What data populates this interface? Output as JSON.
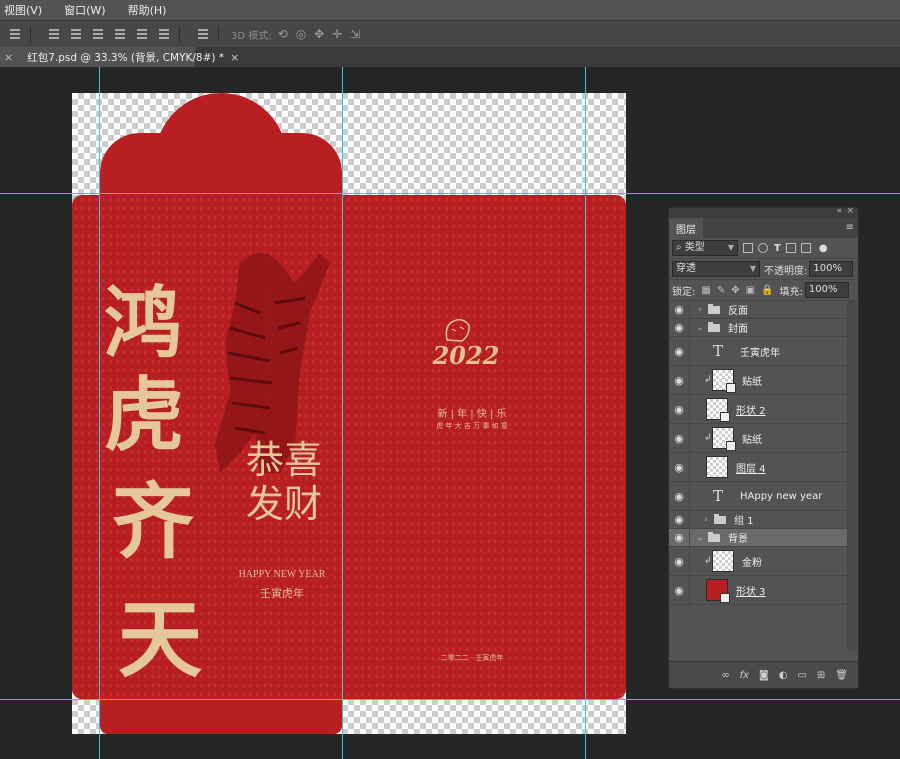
{
  "menu": {
    "items": [
      "视图(V)",
      "窗口(W)",
      "帮助(H)"
    ]
  },
  "optionsbar": {
    "mode_3d_label": "3D 模式:"
  },
  "document_tab": {
    "close_left": "×",
    "title": "红包7.psd @ 33.3% (背景, CMYK/8#) *",
    "close_right": "×"
  },
  "artwork": {
    "calligraphy": [
      "鸿",
      "虎",
      "齐",
      "天"
    ],
    "blessing": [
      "恭喜",
      "发财"
    ],
    "happy_new_year": "HAPPY NEW YEAR",
    "year_name": "壬寅虎年",
    "year_numeral": "2022",
    "greeting_line1": "新 | 年 | 快 | 乐",
    "greeting_line2": "虎 年 大 吉   万 事 如 意",
    "footer_date": "二零二二 · 壬寅虎年"
  },
  "layers_panel": {
    "title": "图层",
    "filter_label": "类型",
    "blend_mode": "穿透",
    "opacity_label": "不透明度:",
    "opacity_value": "100%",
    "lock_label": "锁定:",
    "fill_label": "填充:",
    "fill_value": "100%",
    "layers": [
      {
        "name": "反面",
        "kind": "group",
        "expanded": false
      },
      {
        "name": "封面",
        "kind": "group",
        "expanded": true
      },
      {
        "name": "壬寅虎年",
        "kind": "text"
      },
      {
        "name": "贴纸",
        "kind": "image-clipped"
      },
      {
        "name": "形状 2",
        "kind": "shape"
      },
      {
        "name": "贴纸",
        "kind": "image-clipped"
      },
      {
        "name": "图层 4",
        "kind": "image"
      },
      {
        "name": "HAppy new year",
        "kind": "text"
      },
      {
        "name": "组 1",
        "kind": "group",
        "expanded": false
      },
      {
        "name": "背景",
        "kind": "group",
        "expanded": true,
        "selected": true
      },
      {
        "name": "金粉",
        "kind": "image-clipped"
      },
      {
        "name": "形状 3",
        "kind": "shape-red"
      }
    ],
    "footer_icons": [
      "link-icon",
      "fx-icon",
      "mask-icon",
      "adjustment-icon",
      "folder-icon",
      "new-layer-icon",
      "trash-icon"
    ]
  },
  "colors": {
    "envelope_red": "#b81f22",
    "gold": "#e2c091",
    "guide": "#3fc4d6"
  }
}
